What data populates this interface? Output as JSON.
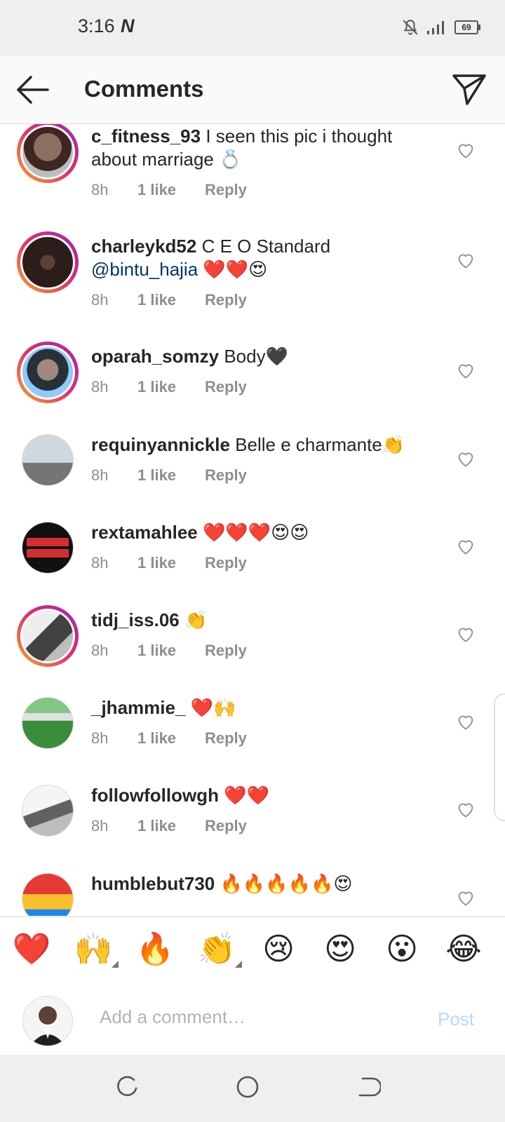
{
  "status_bar": {
    "time": "3:16",
    "carrier_glyph": "N",
    "battery": "69"
  },
  "header": {
    "title": "Comments"
  },
  "comments": [
    {
      "user": "c_fitness_93",
      "text": "I seen this pic i thought about marriage 💍",
      "mention": "",
      "age": "8h",
      "likes": "1 like",
      "reply": "Reply",
      "story": true
    },
    {
      "user": "charleykd52",
      "text": "C E O Standard",
      "mention": "@bintu_hajia",
      "tail": " ❤️❤️😍",
      "age": "8h",
      "likes": "1 like",
      "reply": "Reply",
      "story": true
    },
    {
      "user": "oparah_somzy",
      "text": "Body🖤",
      "mention": "",
      "age": "8h",
      "likes": "1 like",
      "reply": "Reply",
      "story": true
    },
    {
      "user": "requinyannickle",
      "text": "Belle e charmante👏",
      "mention": "",
      "age": "8h",
      "likes": "1 like",
      "reply": "Reply",
      "story": false
    },
    {
      "user": "rextamahlee",
      "text": "❤️❤️❤️😍😍",
      "mention": "",
      "age": "8h",
      "likes": "1 like",
      "reply": "Reply",
      "story": false
    },
    {
      "user": "tidj_iss.06",
      "text": "👏",
      "mention": "",
      "age": "8h",
      "likes": "1 like",
      "reply": "Reply",
      "story": true
    },
    {
      "user": "_jhammie_",
      "text": "❤️🙌",
      "mention": "",
      "age": "8h",
      "likes": "1 like",
      "reply": "Reply",
      "story": false
    },
    {
      "user": "followfollowgh",
      "text": "❤️❤️",
      "mention": "",
      "age": "8h",
      "likes": "1 like",
      "reply": "Reply",
      "story": false
    },
    {
      "user": "humblebut730",
      "text": "🔥🔥🔥🔥🔥😍",
      "mention": "",
      "age": "",
      "likes": "",
      "reply": "",
      "story": false
    }
  ],
  "quick_reactions": [
    "❤️",
    "🙌",
    "🔥",
    "👏",
    "😢",
    "😍",
    "😮",
    "😂"
  ],
  "composer": {
    "placeholder": "Add a comment…",
    "post_label": "Post"
  },
  "icons": {
    "back": "arrow-left-icon",
    "send": "paper-plane-icon",
    "like": "heart-outline-icon",
    "nav_recents": "recents-icon",
    "nav_home": "home-circle-icon",
    "nav_back": "back-icon"
  },
  "colors": {
    "mention": "#003569",
    "muted": "#8e8e8e",
    "post_disabled": "#b3dbff"
  }
}
